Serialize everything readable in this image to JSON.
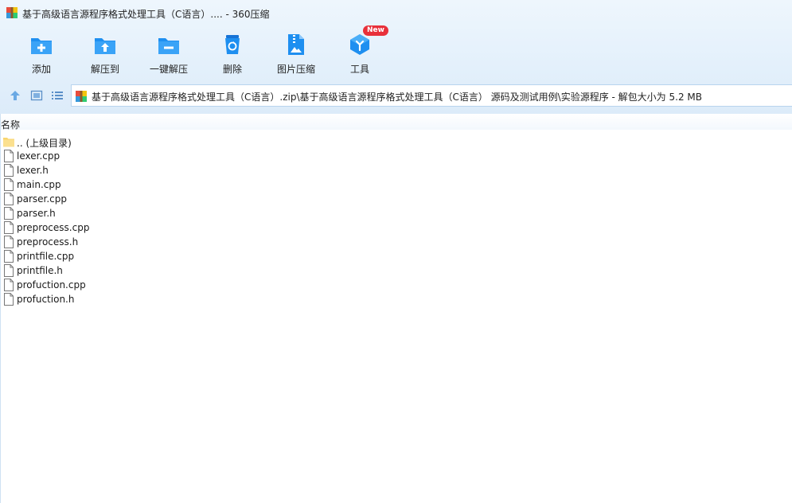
{
  "window": {
    "title": "基于高级语言源程序格式处理工具（C语言）.... - 360压缩"
  },
  "toolbar": {
    "items": [
      {
        "label": "添加",
        "icon": "add-folder-icon"
      },
      {
        "label": "解压到",
        "icon": "extract-to-icon"
      },
      {
        "label": "一键解压",
        "icon": "one-click-extract-icon"
      },
      {
        "label": "删除",
        "icon": "delete-bin-icon"
      },
      {
        "label": "图片压缩",
        "icon": "image-compress-icon"
      },
      {
        "label": "工具",
        "icon": "tools-cube-icon",
        "badge": "New"
      }
    ]
  },
  "path": {
    "text": "基于高级语言源程序格式处理工具（C语言）.zip\\基于高级语言源程序格式处理工具（C语言） 源码及测试用例\\实验源程序 - 解包大小为 5.2 MB"
  },
  "list": {
    "column_name": "名称",
    "files": [
      {
        "name": ".. (上级目录)",
        "type": "folder"
      },
      {
        "name": "lexer.cpp",
        "type": "file"
      },
      {
        "name": "lexer.h",
        "type": "file"
      },
      {
        "name": "main.cpp",
        "type": "file"
      },
      {
        "name": "parser.cpp",
        "type": "file"
      },
      {
        "name": "parser.h",
        "type": "file"
      },
      {
        "name": "preprocess.cpp",
        "type": "file"
      },
      {
        "name": "preprocess.h",
        "type": "file"
      },
      {
        "name": "printfile.cpp",
        "type": "file"
      },
      {
        "name": "printfile.h",
        "type": "file"
      },
      {
        "name": "profuction.cpp",
        "type": "file"
      },
      {
        "name": "profuction.h",
        "type": "file"
      }
    ]
  },
  "colors": {
    "accent": "#1e8ff0",
    "icon_dark": "#1673d6",
    "badge": "#e8303a",
    "folder": "#f9d56e"
  }
}
